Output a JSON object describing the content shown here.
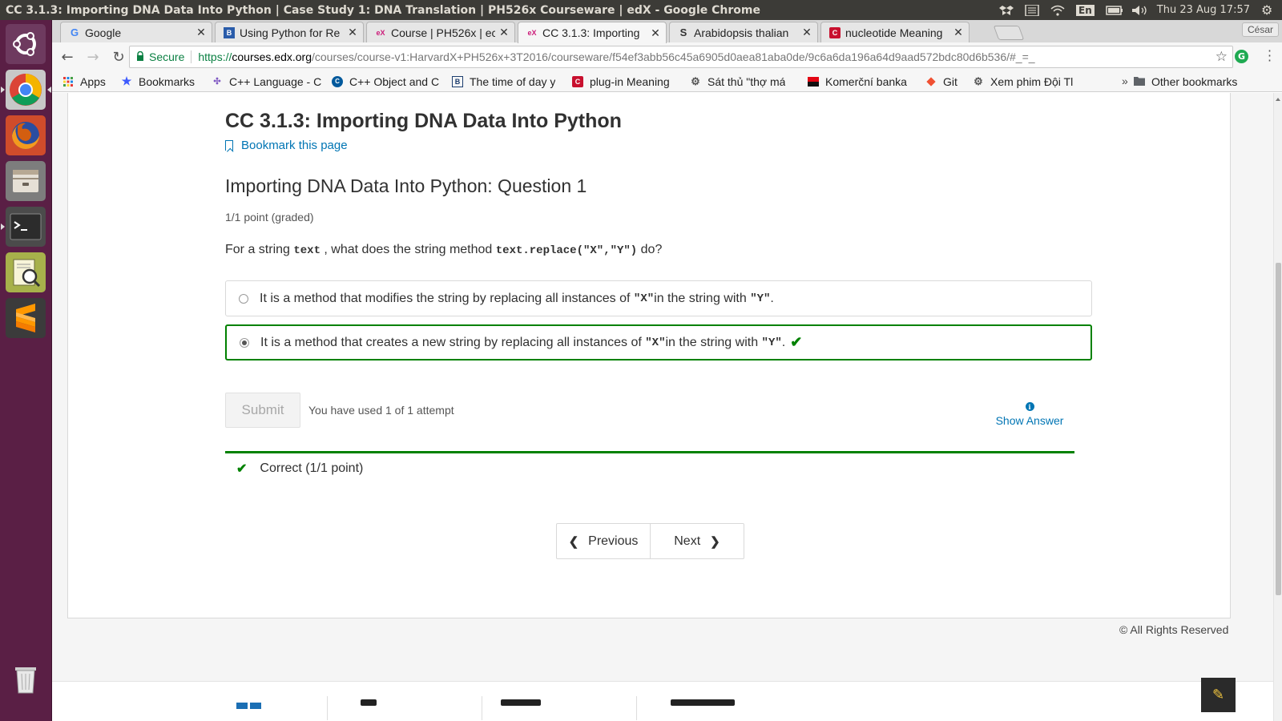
{
  "window": {
    "title": "CC 3.1.3: Importing DNA Data Into Python | Case Study 1: DNA Translation | PH526x Courseware | edX - Google Chrome",
    "keyboard_layout": "En",
    "clock": "Thu 23 Aug 17:57"
  },
  "launcher": {
    "items": [
      {
        "name": "ubuntu-dash-icon"
      },
      {
        "name": "chrome-icon"
      },
      {
        "name": "firefox-icon"
      },
      {
        "name": "files-icon"
      },
      {
        "name": "terminal-icon"
      },
      {
        "name": "document-viewer-icon"
      },
      {
        "name": "sublime-text-icon"
      },
      {
        "name": "trash-icon"
      }
    ]
  },
  "browser": {
    "tabs": [
      {
        "label": "Google",
        "icon": "google-g-icon",
        "active": false
      },
      {
        "label": "Using Python for Re",
        "icon": "book-icon",
        "active": false
      },
      {
        "label": "Course | PH526x | ec",
        "icon": "edx-icon",
        "active": false
      },
      {
        "label": "CC 3.1.3: Importing",
        "icon": "edx-icon",
        "active": true
      },
      {
        "label": "Arabidopsis thalian",
        "icon": "s-icon",
        "active": false
      },
      {
        "label": "nucleotide Meaning",
        "icon": "cambridge-icon",
        "active": false
      }
    ],
    "profile": "César",
    "omnibox": {
      "secure_label": "Secure",
      "url_scheme": "https://",
      "url_host": "courses.edx.org",
      "url_path": "/courses/course-v1:HarvardX+PH526x+3T2016/courseware/f54ef3abb56c45a6905d0aea81aba0de/9c6a6da196a64d9aad572bdc80d6b536/#_=_"
    },
    "bookmarks": [
      {
        "label": "Apps",
        "icon": "apps-grid-icon"
      },
      {
        "label": "Bookmarks",
        "icon": "star-icon"
      },
      {
        "label": "C++ Language - C",
        "icon": "cpp-icon"
      },
      {
        "label": "C++ Object and C",
        "icon": "cpp-hex-icon"
      },
      {
        "label": "The time of day y",
        "icon": "bi-icon"
      },
      {
        "label": "plug-in Meaning",
        "icon": "cambridge-icon"
      },
      {
        "label": "Sát thủ \"thợ má",
        "icon": "gear-icon"
      },
      {
        "label": "Komerční banka",
        "icon": "kb-icon"
      },
      {
        "label": "Git",
        "icon": "git-icon"
      },
      {
        "label": "Xem phim Đội Tl",
        "icon": "gear-icon"
      }
    ],
    "bookmarks_more": "»",
    "other_bookmarks": "Other bookmarks"
  },
  "page": {
    "unit_title": "CC 3.1.3: Importing DNA Data Into Python",
    "bookmark_link": "Bookmark this page",
    "problem_title": "Importing DNA Data Into Python: Question 1",
    "progress": "1/1 point (graded)",
    "question": {
      "p1": "For a string ",
      "c1": "text",
      "p2": " , what does the string method ",
      "c2": "text.replace(\"X\",\"Y\")",
      "p3": " do?"
    },
    "choices": [
      {
        "t1": "It is a method that modifies the string by replacing all instances of ",
        "c1": "\"X\"",
        "t2": " in the string with ",
        "c2": "\"Y\"",
        "t3": " .",
        "selected": false,
        "correct": false
      },
      {
        "t1": "It is a method that creates a new string by replacing all instances of ",
        "c1": "\"X\"",
        "t2": " in the string with ",
        "c2": "\"Y\"",
        "t3": " .",
        "selected": true,
        "correct": true
      }
    ],
    "submit_label": "Submit",
    "attempts": "You have used 1 of 1 attempt",
    "show_answer": "Show Answer",
    "feedback": "Correct (1/1 point)",
    "prev_label": "Previous",
    "next_label": "Next",
    "copyright": "© All Rights Reserved"
  },
  "colors": {
    "correct_green": "#008100",
    "link_blue": "#0075b4",
    "launcher_bg": "#5a1f45",
    "panel_bg": "#3c3b37"
  }
}
